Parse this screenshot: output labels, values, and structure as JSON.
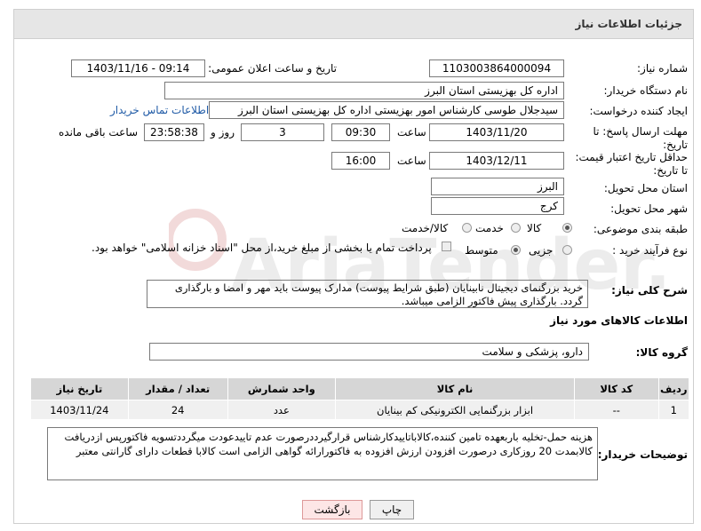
{
  "header": {
    "title": "جزئیات اطلاعات نیاز"
  },
  "labels": {
    "need_number": "شماره نیاز:",
    "announce_datetime": "تاریخ و ساعت اعلان عمومی:",
    "buyer_org": "نام دستگاه خریدار:",
    "request_creator": "ایجاد کننده درخواست:",
    "reply_deadline": "مهلت ارسال پاسخ: تا تاریخ:",
    "price_validity": "حداقل تاریخ اعتبار قیمت: تا تاریخ:",
    "time": "ساعت",
    "time2": "ساعت",
    "days_and": "روز و",
    "hours_left": "ساعت باقی مانده",
    "province": "استان محل تحویل:",
    "city": "شهر محل تحویل:",
    "category": "طبقه بندی موضوعی:",
    "purchase_type": "نوع فرآیند خرید :",
    "general_desc": "شرح کلی نیاز:",
    "goods_info": "اطلاعات کالاهای مورد نیاز",
    "goods_group": "گروه کالا:",
    "buyer_notes": "توضیحات خریدار:"
  },
  "values": {
    "need_number": "1103003864000094",
    "announce_datetime": "1403/11/16 - 09:14",
    "buyer_org": "اداره کل بهزیستی استان البرز",
    "request_creator": "سیدجلال طوسی کارشناس امور بهزیستی اداره کل بهزیستی استان البرز",
    "contact_link": "اطلاعات تماس خریدار",
    "reply_date": "1403/11/20",
    "reply_time": "09:30",
    "days_left": "3",
    "time_left": "23:58:38",
    "validity_date": "1403/12/11",
    "validity_time": "16:00",
    "province": "البرز",
    "city": "کرج",
    "category_options": [
      "کالا",
      "خدمت",
      "کالا/خدمت"
    ],
    "purchase_options": [
      "جزیی",
      "متوسط"
    ],
    "payment_note": "پرداخت تمام یا بخشی از مبلغ خرید،از محل \"اسناد خزانه اسلامی\" خواهد بود.",
    "general_desc": "خرید بزرگنمای دیجیتال نابینایان (طبق شرایط پیوست) مدارک پیوست باید مهر و امضا و بارگذاری گردد. بارگذاری پیش فاکتور الزامی میباشد.",
    "goods_group": "دارو، پزشکی و سلامت",
    "buyer_notes": "هزینه حمل-تخلیه باربعهده تامین کننده،کالاباتاییدکارشناس قرارگیرددرصورت عدم تاییدعودت میگرددتسویه فاکتورپس ازدریافت کالابمدت 20 روزکاری درصورت افزودن ارزش افزوده به فاکتورارائه گواهی الزامی است کالابا قطعات دارای گارانتی معتبر"
  },
  "table": {
    "headers": [
      "ردیف",
      "کد کالا",
      "نام کالا",
      "واحد شمارش",
      "تعداد / مقدار",
      "تاریخ نیاز"
    ],
    "rows": [
      [
        "1",
        "--",
        "ابزار بزرگنمایی الکترونیکی کم بینایان",
        "عدد",
        "24",
        "1403/11/24"
      ]
    ]
  },
  "buttons": {
    "print": "چاپ",
    "back": "بازگشت"
  },
  "watermark": {
    "text": "AriaTender.neT"
  }
}
